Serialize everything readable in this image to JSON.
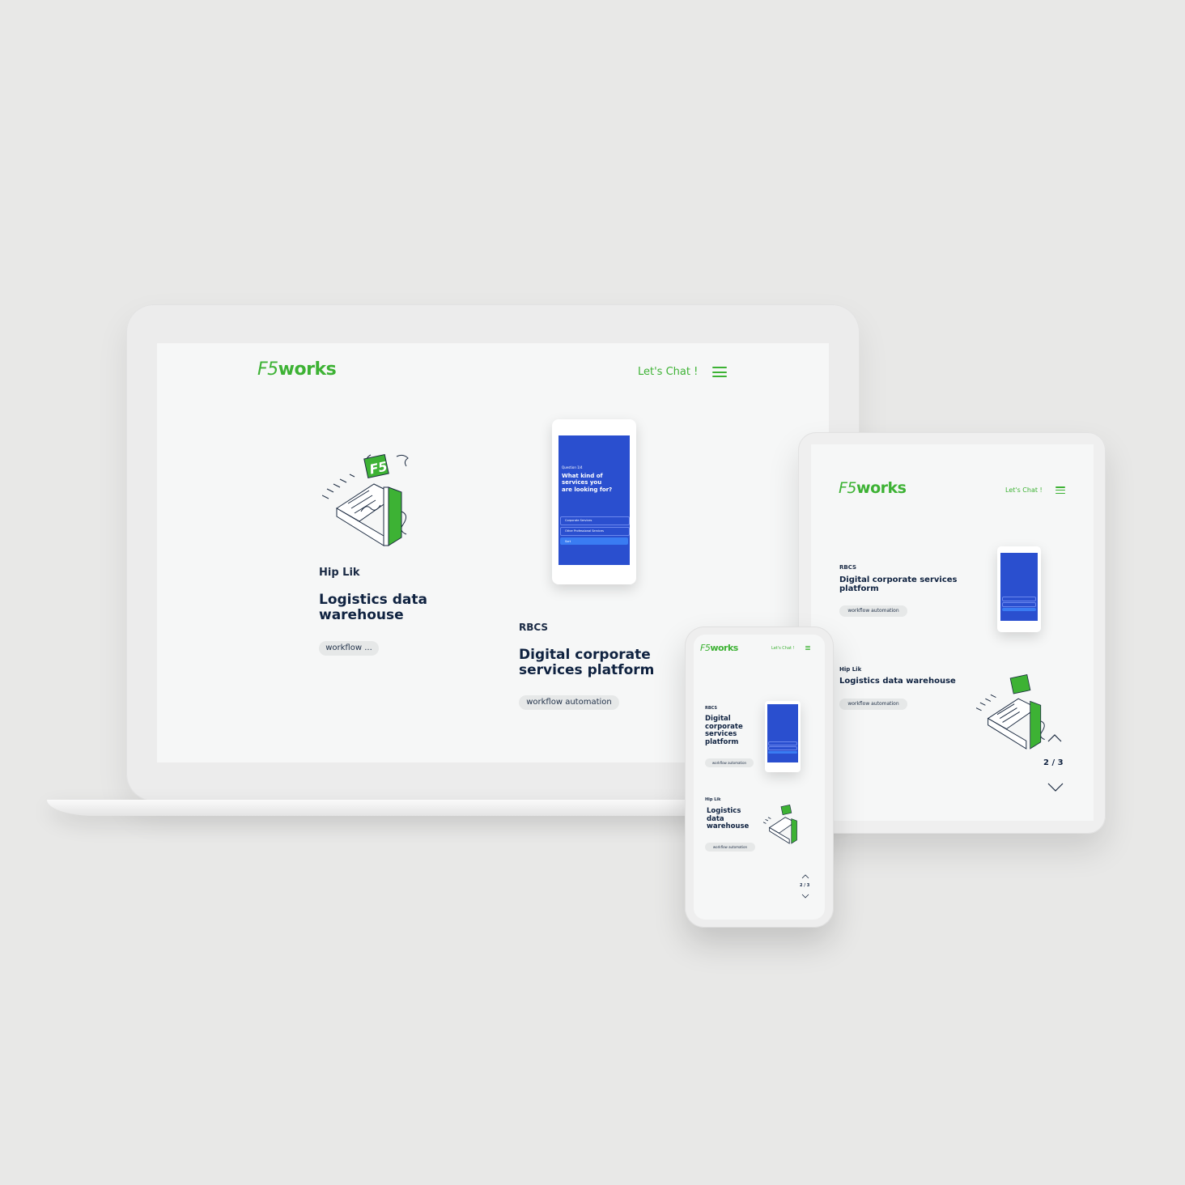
{
  "colors": {
    "accent_green": "#3db234",
    "navy": "#0f2240",
    "mock_blue": "#2a4fcf",
    "tag_bg": "#e6e8e8"
  },
  "laptop": {
    "logo_prefix": "F5",
    "logo_suffix": "works",
    "cta": "Let's Chat !",
    "projects": [
      {
        "client": "Hip Lik",
        "title": "Logistics data warehouse",
        "tag": "workflow ..."
      },
      {
        "client": "RBCS",
        "title": "Digital corporate services platform",
        "tag": "workflow automation"
      }
    ],
    "mock": {
      "question": "Question 1/4",
      "prompt": "What kind of services you are looking for?",
      "opt1": "Corporate Services",
      "opt2": "Other Professional Services",
      "btn": "Sort"
    }
  },
  "tablet": {
    "logo_prefix": "F5",
    "logo_suffix": "works",
    "cta": "Let's Chat !",
    "projects": [
      {
        "client": "RBCS",
        "title": "Digital corporate services platform",
        "tag": "workflow automation"
      },
      {
        "client": "Hip Lik",
        "title": "Logistics data warehouse",
        "tag": "workflow automation"
      }
    ],
    "pager": "2 / 3"
  },
  "phone": {
    "logo_prefix": "F5",
    "logo_suffix": "works",
    "cta": "Let's Chat !",
    "projects": [
      {
        "client": "RBCS",
        "title": "Digital corporate services platform",
        "tag": "workflow automation"
      },
      {
        "client": "Hip Lik",
        "title": "Logistics data warehouse",
        "tag": "workflow automation"
      }
    ],
    "pager": "2 / 3"
  },
  "icons": [
    "menu-icon",
    "chevron-up-icon",
    "chevron-down-icon",
    "mailbox-illustration"
  ]
}
